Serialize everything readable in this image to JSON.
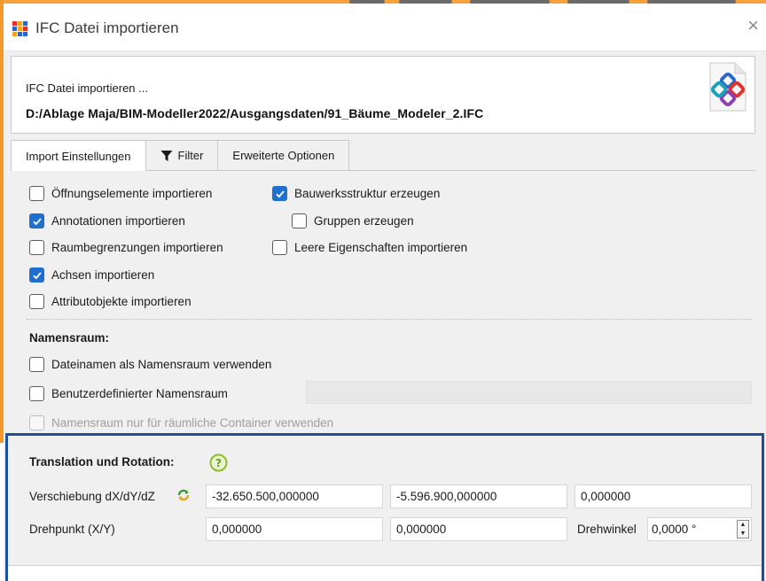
{
  "window": {
    "title": "IFC Datei importieren",
    "close_glyph": "×"
  },
  "header": {
    "caption": "IFC Datei importieren ...",
    "file_path": "D:/Ablage Maja/BIM-Modeller2022/Ausgangsdaten/91_Bäume_Modeler_2.IFC",
    "logo_icon": "ifc-logo-icon"
  },
  "tabs": [
    {
      "label": "Import Einstellungen",
      "active": true
    },
    {
      "label": "Filter",
      "icon": "filter-icon",
      "active": false
    },
    {
      "label": "Erweiterte Optionen",
      "active": false
    }
  ],
  "options_left": [
    {
      "label": "Öffnungselemente importieren",
      "checked": false
    },
    {
      "label": "Annotationen importieren",
      "checked": true
    },
    {
      "label": "Raumbegrenzungen importieren",
      "checked": false
    },
    {
      "label": "Achsen importieren",
      "checked": true
    },
    {
      "label": "Attributobjekte importieren",
      "checked": false
    }
  ],
  "options_right": [
    {
      "label": "Bauwerksstruktur erzeugen",
      "checked": true
    },
    {
      "label": "Gruppen erzeugen",
      "checked": false
    },
    {
      "label": "Leere Eigenschaften importieren",
      "checked": false
    }
  ],
  "namespace": {
    "heading": "Namensraum:",
    "options": [
      {
        "label": "Dateinamen als Namensraum verwenden",
        "checked": false,
        "enabled": true
      },
      {
        "label": "Benutzerdefinierter Namensraum",
        "checked": false,
        "enabled": true
      },
      {
        "label": "Namensraum nur für räumliche Container verwenden",
        "checked": false,
        "enabled": false
      }
    ],
    "custom_value": ""
  },
  "transform": {
    "heading": "Translation und Rotation:",
    "help_icon": "help-icon",
    "shift_label": "Verschiebung dX/dY/dZ",
    "shift_icon": "refresh-icon",
    "dx": "-32.650.500,000000",
    "dy": "-5.596.900,000000",
    "dz": "0,000000",
    "pivot_label": "Drehpunkt (X/Y)",
    "pivot_x": "0,000000",
    "pivot_y": "0,000000",
    "rotation_label": "Drehwinkel",
    "rotation_value": "0,0000 °"
  },
  "colors": {
    "accent_blue": "#1f6fd1",
    "highlight_frame": "#1d4f9c",
    "orange_frame": "#f39a2a",
    "help_green": "#8bbf2a"
  }
}
